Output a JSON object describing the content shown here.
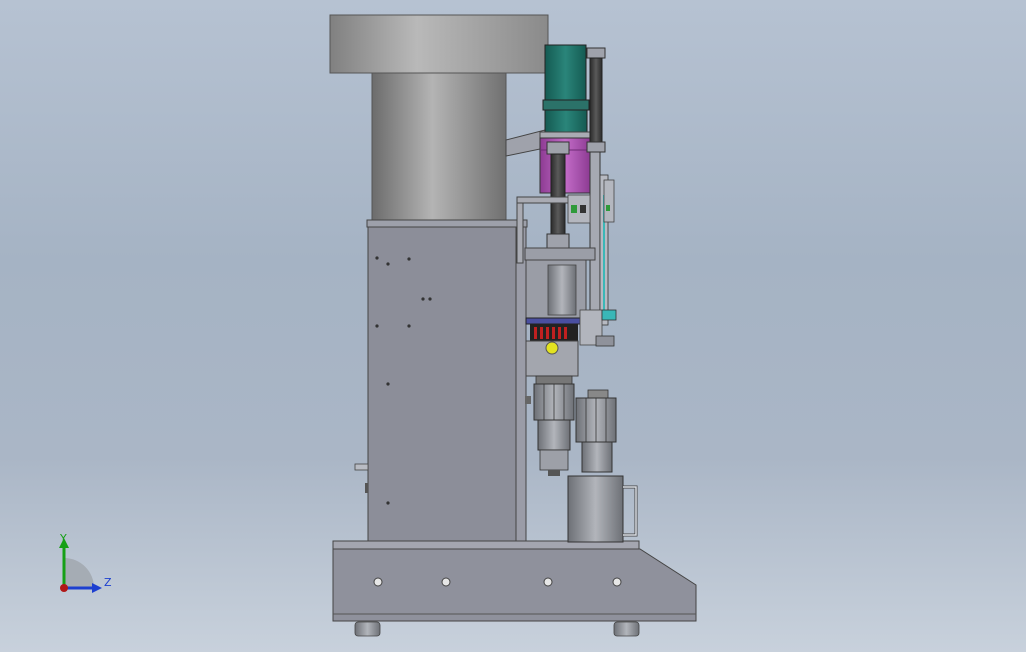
{
  "viewport": {
    "background_top": "#b6c2d2",
    "background_bottom": "#c8d1dc",
    "part_colors": {
      "hopper": "#9a9a9a",
      "cabinet": "#8c8e99",
      "base": "#8f919c",
      "motor_green": "#1f6f66",
      "motor_purple": "#b05ab6",
      "dark_rod": "#3a3a3a",
      "yellow_knob": "#e3e320"
    }
  },
  "triad": {
    "y_label": "Y",
    "z_label": "Z",
    "y_color": "#16a016",
    "z_color": "#1d3fd0",
    "origin_color": "#b01818"
  }
}
